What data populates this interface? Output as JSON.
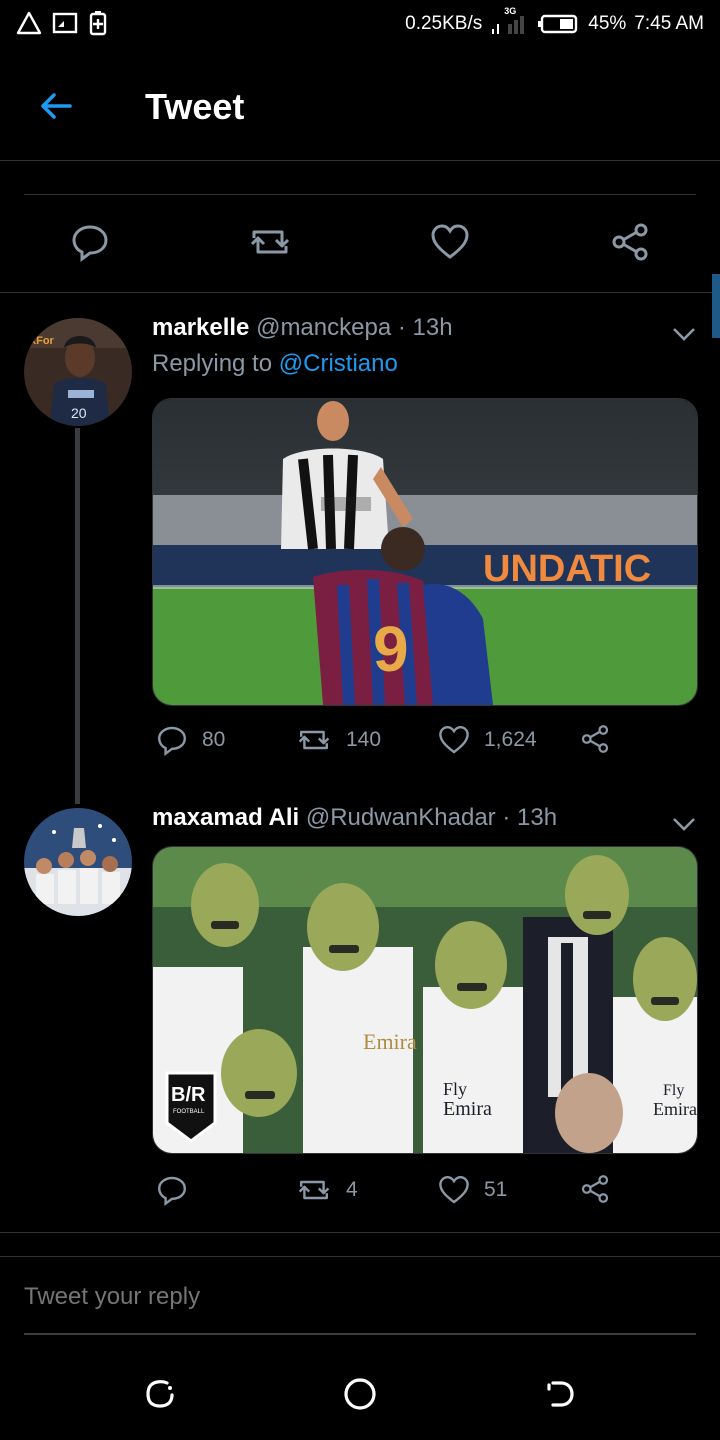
{
  "status_bar": {
    "speed": "0.25KB/s",
    "network": "3G",
    "battery": "45%",
    "time": "7:45 AM",
    "icons": [
      "warning-icon",
      "screen-cast-icon",
      "battery-saver-icon"
    ]
  },
  "header": {
    "title": "Tweet"
  },
  "accent_color": "#1d9bf0",
  "tweets": [
    {
      "name": "markelle",
      "handle": "@manckepa",
      "time": "· 13h",
      "replying_prefix": "Replying to",
      "replying_to": "@Cristiano",
      "replies": "80",
      "retweets": "140",
      "likes": "1,624",
      "avatar_icon": "avatar-basketball-player",
      "media_icon": "photo-soccer-celebration"
    },
    {
      "name": "maxamad Ali",
      "handle": "@RudwanKhadar",
      "time": "· 13h",
      "replies": "",
      "retweets": "4",
      "likes": "51",
      "avatar_icon": "avatar-team-celebration",
      "media_icon": "photo-real-madrid-meme",
      "media_badge": "B/R",
      "media_badge_sub": "FOOTBALL"
    }
  ],
  "reply_box": {
    "placeholder": "Tweet your reply"
  }
}
